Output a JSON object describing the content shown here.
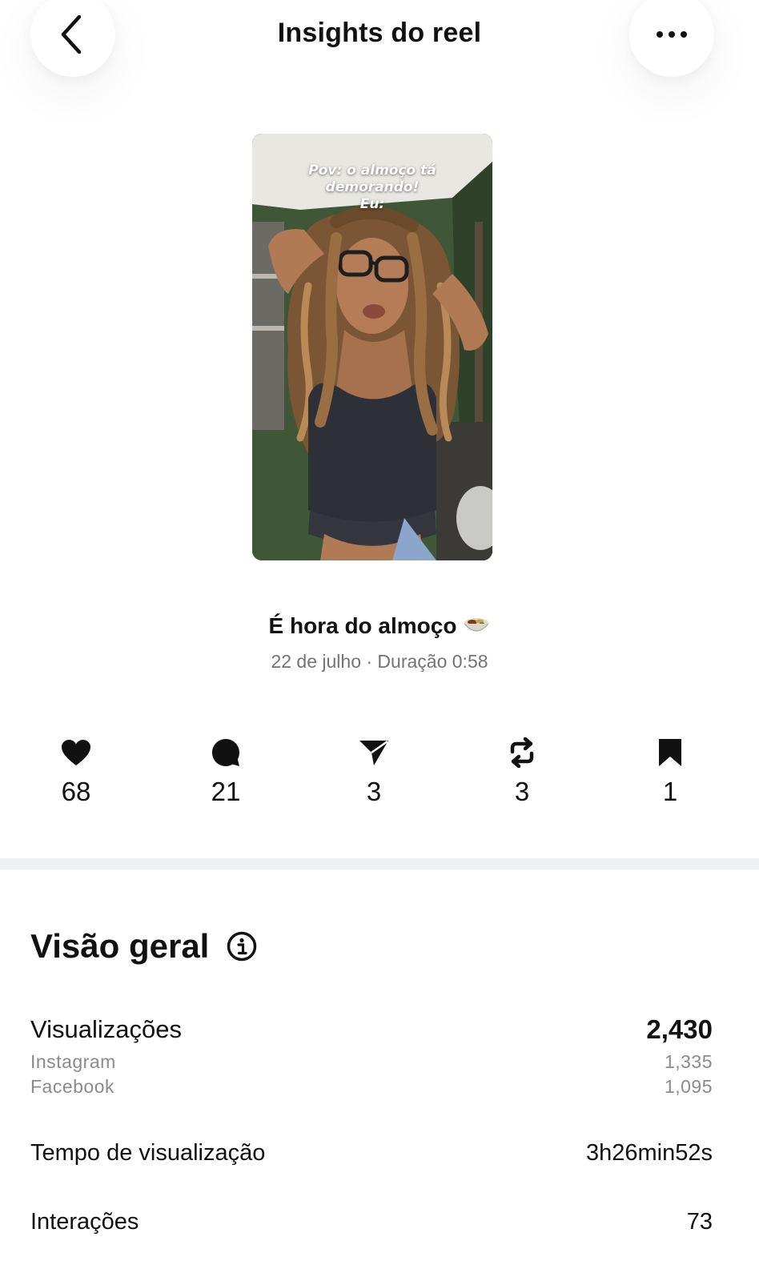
{
  "header": {
    "title": "Insights do reel",
    "back_icon": "chevron-left-icon",
    "more_icon": "more-horizontal-icon"
  },
  "reel": {
    "thumbnail_caption_lines": [
      "Pov: o almoço tá",
      "demorando!",
      "Eu:"
    ],
    "title": "É hora do almoço",
    "title_emoji_icon": "bowl-of-food-icon",
    "meta": "22 de julho · Duração 0:58"
  },
  "stats": [
    {
      "icon": "heart-icon",
      "value": "68"
    },
    {
      "icon": "comment-icon",
      "value": "21"
    },
    {
      "icon": "send-icon",
      "value": "3"
    },
    {
      "icon": "repost-icon",
      "value": "3"
    },
    {
      "icon": "bookmark-icon",
      "value": "1"
    }
  ],
  "overview": {
    "title": "Visão geral",
    "info_icon": "info-icon",
    "views": {
      "label": "Visualizações",
      "value": "2,430",
      "breakdown": [
        {
          "label": "Instagram",
          "value": "1,335"
        },
        {
          "label": "Facebook",
          "value": "1,095"
        }
      ]
    },
    "watch_time": {
      "label": "Tempo de visualização",
      "value": "3h26min52s"
    },
    "interactions": {
      "label": "Interações",
      "value": "73"
    }
  },
  "colors": {
    "text_primary": "#111111",
    "text_secondary": "#737373",
    "divider": "#eff0f3",
    "background": "#ffffff"
  }
}
